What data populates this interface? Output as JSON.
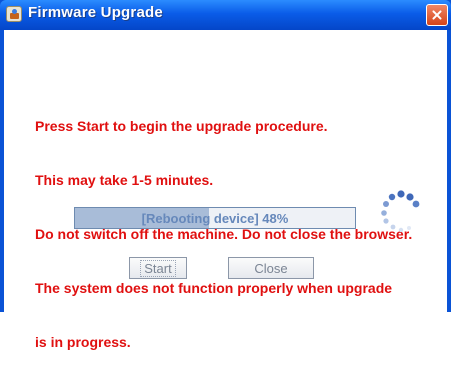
{
  "window": {
    "title": "Firmware Upgrade"
  },
  "message": {
    "lines": [
      "Press Start to begin the upgrade procedure.",
      "This may take 1-5 minutes.",
      "Do not switch off the machine. Do not close the browser.",
      "The system does not function properly when upgrade",
      "is in progress."
    ],
    "color": "#e01010"
  },
  "progress": {
    "text": "[Rebooting device] 48%",
    "percent": 48
  },
  "buttons": {
    "start_label": "Start",
    "close_label": "Close"
  },
  "icons": {
    "title": "java-cup-icon",
    "close": "close-icon",
    "spinner": "loading-spinner-icon"
  }
}
